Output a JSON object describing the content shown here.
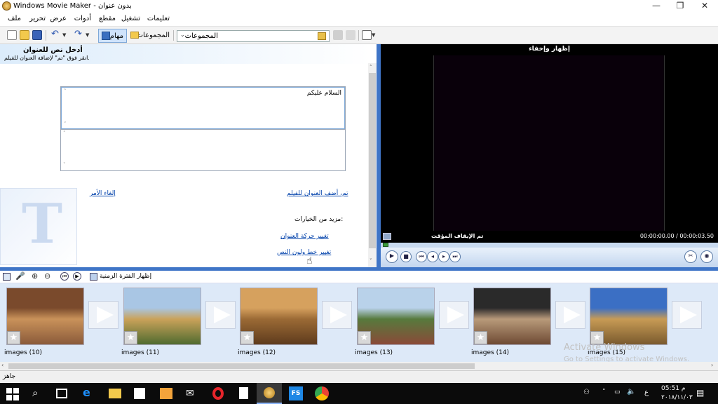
{
  "window": {
    "title": "Windows Movie Maker - بدون عنوان",
    "controls": {
      "minimize": "—",
      "restore": "❐",
      "close": "✕"
    }
  },
  "menu": [
    "ملف",
    "تحرير",
    "عرض",
    "أدوات",
    "مقطع",
    "تشغيل",
    "تعليمات"
  ],
  "toolbar": {
    "tasks_label": "مهام",
    "collections_label": "المجموعات",
    "collections_combo_value": "المجموعات"
  },
  "task_pane": {
    "heading": "أدخل نص للعنوان",
    "instruction": "انقر فوق \"تم\" لإضافة العنوان للفيلم.",
    "title_text": "السلام عليكم",
    "subtitle_text": "",
    "done_link": "تم، أضف العنوان للفيلم",
    "cancel_link": "إلغاء الأمر",
    "more_options_label": "مزيد من الخيارات:",
    "options": [
      "تغيير حركة العنوان",
      "تغيير خط ولون النص"
    ],
    "logo_letter": "T"
  },
  "preview": {
    "header": "إظهار وإخفاء",
    "status": "تم الإيقاف المؤقت",
    "time": "00:00:00.00 / 00:00:03.50"
  },
  "storyboard": {
    "show_timeline_label": "إظهار الفترة الزمنية",
    "clips": [
      {
        "label": "images (10)",
        "colors": [
          "#7a4a2c",
          "#c9925a",
          "#8a5a3a"
        ]
      },
      {
        "label": "images (11)",
        "colors": [
          "#a9c6e4",
          "#caa25a",
          "#4f6b2f"
        ]
      },
      {
        "label": "images (12)",
        "colors": [
          "#d6a15e",
          "#9b6a35",
          "#5e3b1d"
        ]
      },
      {
        "label": "images (13)",
        "colors": [
          "#b9d2ea",
          "#577a3d",
          "#8a4a38"
        ]
      },
      {
        "label": "images (14)",
        "colors": [
          "#2a2a2a",
          "#b89a7a",
          "#6e4a33"
        ]
      },
      {
        "label": "images (15)",
        "colors": [
          "#3b6fc4",
          "#c79b55",
          "#7a5a2e"
        ]
      }
    ]
  },
  "status_bar": {
    "text": "جاهز"
  },
  "watermark": {
    "line1": "Activate Windows",
    "line2": "Go to Settings to activate Windows."
  },
  "taskbar": {
    "time": "05:51 م",
    "date": "٢٠١٨/١١/٠٣",
    "lang": "ع"
  }
}
